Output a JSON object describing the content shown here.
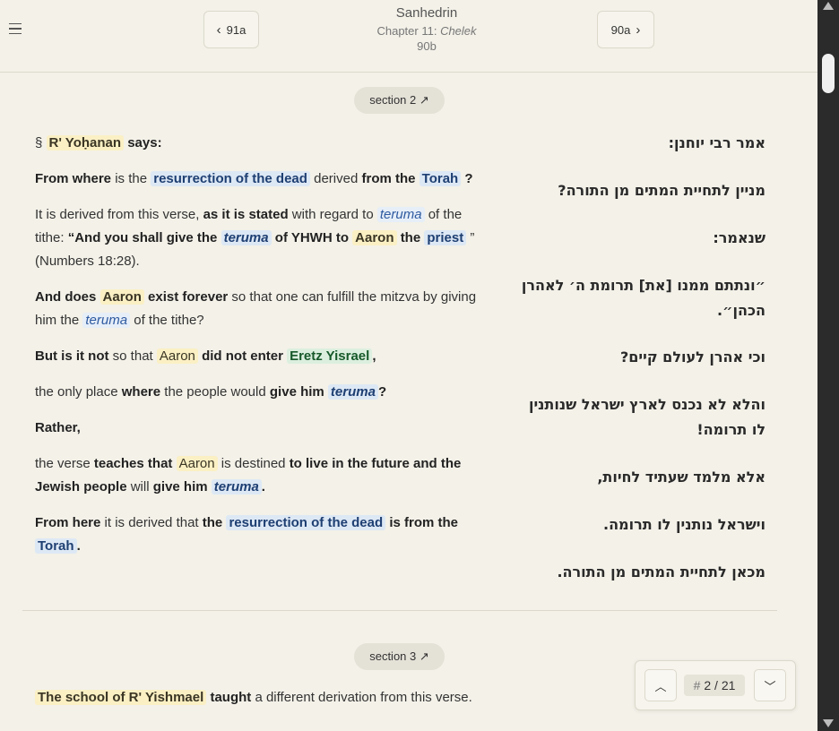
{
  "header": {
    "menu_icon": "hamburger-icon",
    "prev_label": "91a",
    "next_label": "90a",
    "tractate": "Sanhedrin",
    "chapter_prefix": "Chapter 11: ",
    "chapter_name": "Chelek",
    "daf": "90b"
  },
  "sections": [
    {
      "label": "section 2 ↗"
    },
    {
      "label": "section 3 ↗"
    }
  ],
  "english": {
    "p1": {
      "a": "§",
      "b": "R' Yoḥanan",
      "c": "says:"
    },
    "p2": {
      "a": "From where",
      "b": "is the",
      "c": "resurrection of the dead",
      "d": "derived",
      "e": "from the",
      "f": "Torah",
      "g": "?"
    },
    "p3": {
      "a": "It is derived from this verse,",
      "b": "as it is stated",
      "c": "with regard to",
      "d": "teruma",
      "e": "of the tithe:",
      "f": "“And you shall give the",
      "g": "teruma",
      "h": "of YHWH to",
      "i": "Aaron",
      "j": "the",
      "k": "priest",
      "l": "” (Numbers 18:28)."
    },
    "p4": {
      "a": "And does",
      "b": "Aaron",
      "c": "exist forever",
      "d": "so that one can fulfill the mitzva by giving him the",
      "e": "teruma",
      "f": "of the tithe?"
    },
    "p5": {
      "a": "But is it not",
      "b": "so that",
      "c": "Aaron",
      "d": "did not enter",
      "e": "Eretz Yisrael",
      "f": ","
    },
    "p6": {
      "a": "the only place",
      "b": "where",
      "c": "the people would",
      "d": "give him",
      "e": "teruma",
      "f": "?"
    },
    "p7": {
      "a": "Rather,"
    },
    "p8": {
      "a": "the verse",
      "b": "teaches that",
      "c": "Aaron",
      "d": "is destined",
      "e": "to live in the future and the Jewish people",
      "f": "will",
      "g": "give him",
      "h": "teruma",
      "i": "."
    },
    "p9": {
      "a": "From here",
      "b": "it is derived that",
      "c": "the",
      "d": "resurrection of the dead",
      "e": "is from the",
      "f": "Torah",
      "g": "."
    },
    "p10": {
      "a": "The school of R' Yishmael",
      "b": "taught",
      "c": "a different derivation from this verse."
    }
  },
  "hebrew": [
    "אמר רבי יוחנן:",
    "מניין לתחיית המתים מן התורה?",
    "שנאמר:",
    "״ונתתם ממנו [את] תרומת ה׳ לאהרן הכהן״.",
    "וכי אהרן לעולם קיים?",
    "והלא לא נכנס לארץ ישראל שנותנין לו תרומה!",
    "אלא מלמד שעתיד לחיות,",
    "וישראל נותנין לו תרומה.",
    "מכאן לתחיית המתים מן התורה."
  ],
  "finder": {
    "up_icon": "chevron-up-icon",
    "down_icon": "chevron-down-icon",
    "hash": "#",
    "count": "2 / 21"
  },
  "colors": {
    "background": "#f3f1e8",
    "name_highlight": "#fbf0c4",
    "concept_highlight": "#dde8f5",
    "place_highlight": "#dcefdf"
  }
}
